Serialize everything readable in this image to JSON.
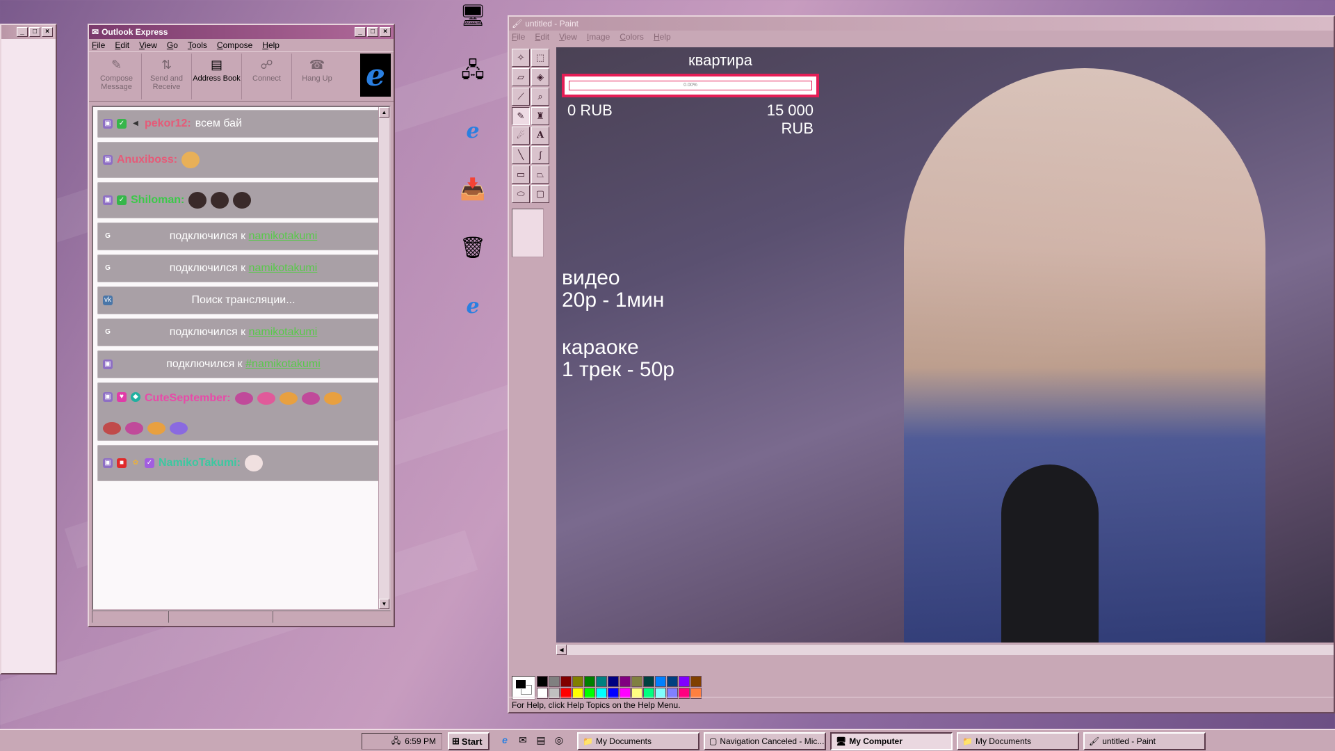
{
  "outlook": {
    "title": "Outlook Express",
    "menu": [
      "File",
      "Edit",
      "View",
      "Go",
      "Tools",
      "Compose",
      "Help"
    ],
    "toolbar": [
      {
        "label": "Compose Message",
        "icon": "compose-icon"
      },
      {
        "label": "Send and Receive",
        "icon": "send-receive-icon"
      },
      {
        "label": "Address Book",
        "icon": "address-book-icon"
      },
      {
        "label": "Connect",
        "icon": "connect-icon"
      },
      {
        "label": "Hang Up",
        "icon": "hang-up-icon"
      }
    ],
    "chat": [
      {
        "nick": "pekor12:",
        "text": "всем бай",
        "nick_color": "#e65a78"
      },
      {
        "nick": "Anuxiboss:",
        "text": "",
        "nick_color": "#e65a78"
      },
      {
        "nick": "Shiloman:",
        "text": "",
        "nick_color": "#3cc84a"
      },
      {
        "text": "подключился к",
        "link": "namikotakumi"
      },
      {
        "text": "подключился к",
        "link": "namikotakumi"
      },
      {
        "text": "Поиск трансляции..."
      },
      {
        "text": "подключился к",
        "link": "namikotakumi"
      },
      {
        "text": "подключился к",
        "link": "#namikotakumi"
      },
      {
        "nick": "CuteSeptember:",
        "text": "",
        "nick_color": "#e84aa8"
      },
      {
        "nick": "NamikoTakumi:",
        "text": "",
        "nick_color": "#3cc8a0"
      }
    ]
  },
  "paint": {
    "title": "untitled - Paint",
    "menu": [
      "File",
      "Edit",
      "View",
      "Image",
      "Colors",
      "Help"
    ],
    "status": "For Help, click Help Topics on the Help Menu.",
    "overlay": {
      "goal_title": "квартира",
      "goal_percent_text": "0.00%",
      "goal_progress": 0,
      "goal_min": "0 RUB",
      "goal_max_line1": "15 000",
      "goal_max_line2": "RUB",
      "video_line1": "видео",
      "video_line2": "20р - 1мин",
      "karaoke_line1": "караоке",
      "karaoke_line2": "1 трек - 50р"
    },
    "palette": [
      "#000000",
      "#808080",
      "#800000",
      "#808000",
      "#008000",
      "#008080",
      "#000080",
      "#800080",
      "#808040",
      "#004040",
      "#0080ff",
      "#004080",
      "#8000ff",
      "#804000",
      "#ffffff",
      "#c0c0c0",
      "#ff0000",
      "#ffff00",
      "#00ff00",
      "#00ffff",
      "#0000ff",
      "#ff00ff",
      "#ffff80",
      "#00ff80",
      "#80ffff",
      "#8080ff",
      "#ff0080",
      "#ff8040"
    ]
  },
  "taskbar": {
    "clock": "6:59 PM",
    "start": "Start",
    "tasks": [
      {
        "label": "My Documents",
        "active": false
      },
      {
        "label": "Navigation Canceled - Mic...",
        "active": false
      },
      {
        "label": "My Computer",
        "active": true
      },
      {
        "label": "My Documents",
        "active": false
      },
      {
        "label": "untitled - Paint",
        "active": false
      }
    ]
  }
}
